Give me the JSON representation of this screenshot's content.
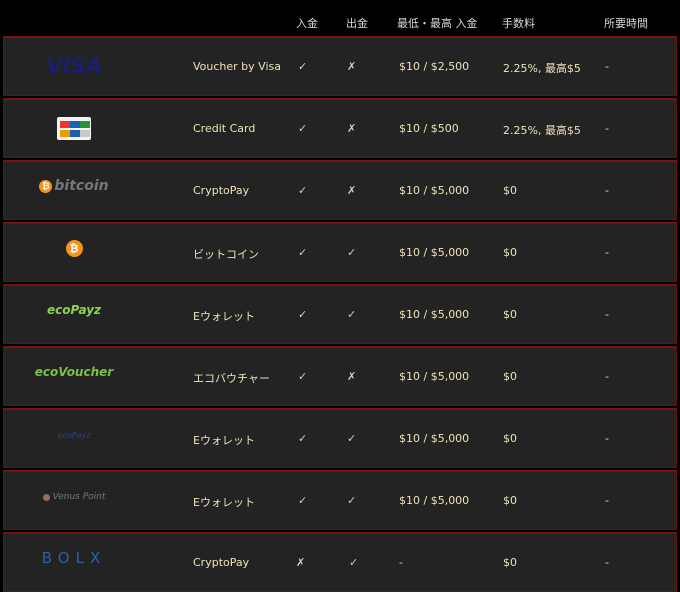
{
  "header": {
    "deposit": "入金",
    "withdrawal": "出金",
    "min_max": "最低・最高 入金",
    "fee": "手数料",
    "time": "所要時間"
  },
  "rows": [
    {
      "logo": "VISA",
      "method": "Voucher by Visa",
      "deposit": "✓",
      "withdrawal": "✗",
      "range": "$10 / $2,500",
      "fee": "2.25%, 最高$5",
      "time": "-"
    },
    {
      "logo": "",
      "method": "Credit Card",
      "deposit": "✓",
      "withdrawal": "✗",
      "range": "$10 / $500",
      "fee": "2.25%, 最高$5",
      "time": "-"
    },
    {
      "logo": "bitcoin",
      "method": "CryptoPay",
      "deposit": "✓",
      "withdrawal": "✗",
      "range": "$10 / $5,000",
      "fee": "$0",
      "time": "-"
    },
    {
      "logo": "",
      "method": "ビットコイン",
      "deposit": "✓",
      "withdrawal": "✓",
      "range": "$10 / $5,000",
      "fee": "$0",
      "time": "-"
    },
    {
      "logo": "ecoPayz",
      "method": "Eウォレット",
      "deposit": "✓",
      "withdrawal": "✓",
      "range": "$10 / $5,000",
      "fee": "$0",
      "time": "-"
    },
    {
      "logo": "ecoVoucher",
      "method": "エコバウチャー",
      "deposit": "✓",
      "withdrawal": "✗",
      "range": "$10 / $5,000",
      "fee": "$0",
      "time": "-"
    },
    {
      "logo": "ecoPayz",
      "method": "Eウォレット",
      "deposit": "✓",
      "withdrawal": "✓",
      "range": "$10 / $5,000",
      "fee": "$0",
      "time": "-"
    },
    {
      "logo": "Venus Point",
      "method": "Eウォレット",
      "deposit": "✓",
      "withdrawal": "✓",
      "range": "$10 / $5,000",
      "fee": "$0",
      "time": "-"
    },
    {
      "logo": "BOLX",
      "method": "CryptoPay",
      "deposit": "✗",
      "withdrawal": "✓",
      "range": "-",
      "fee": "$0",
      "time": "-"
    }
  ],
  "logo_glyphs": {
    "bitcoin_symbol": "₿"
  },
  "colors": {
    "row_border": "#7a1212",
    "row_background": "#232323",
    "text": "#eee3b8"
  }
}
